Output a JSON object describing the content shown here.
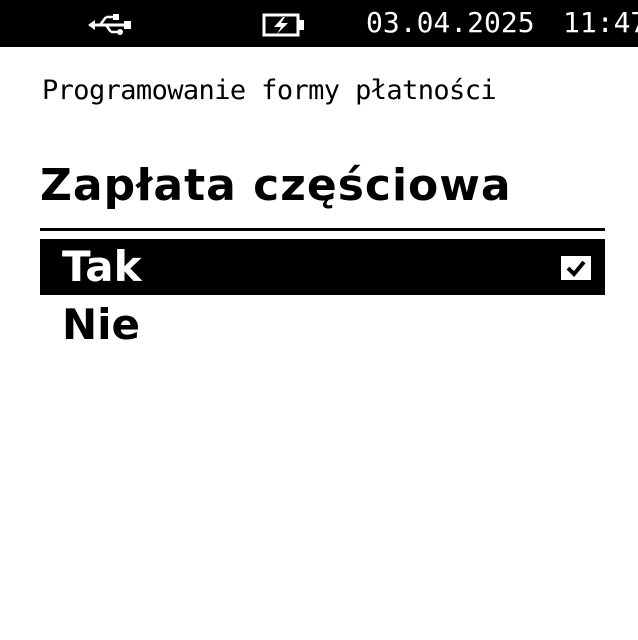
{
  "status_bar": {
    "usb_icon": "usb-icon",
    "battery_icon": "battery-charging-icon",
    "date": "03.04.2025",
    "time": "11:47"
  },
  "screen": {
    "subtitle": "Programowanie formy płatności",
    "title": "Zapłata częściowa"
  },
  "options": [
    {
      "label": "Tak",
      "selected": true,
      "checked_icon": "checkmark-icon"
    },
    {
      "label": "Nie",
      "selected": false
    }
  ],
  "colors": {
    "background": "#ffffff",
    "foreground": "#000000",
    "highlight": "#000000"
  }
}
